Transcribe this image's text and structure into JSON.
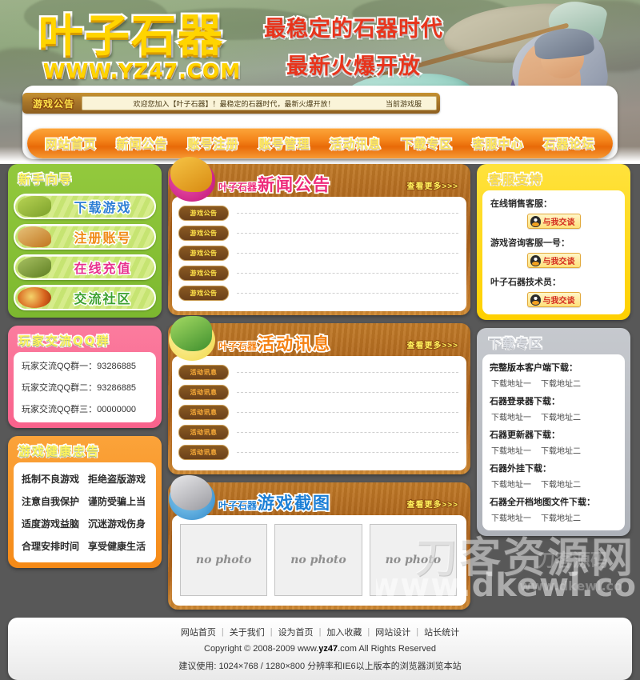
{
  "site": {
    "logo_main": "叶子石器",
    "logo_sub": "WWW.YZ47.COM",
    "slogan_line1": "最稳定的石器时代",
    "slogan_line2": "最新火爆开放"
  },
  "notice": {
    "tag": "游戏公告",
    "text": "欢迎您加入【叶子石器】！最稳定的石器时代，最新火爆开放！",
    "server_label": "当前游戏服"
  },
  "nav": {
    "items": [
      {
        "label": "网站首页"
      },
      {
        "label": "新闻公告"
      },
      {
        "label": "账号注册"
      },
      {
        "label": "账号管理"
      },
      {
        "label": "活动讯息"
      },
      {
        "label": "下载专区"
      },
      {
        "label": "客服中心"
      },
      {
        "label": "石器论坛"
      }
    ]
  },
  "newbie_guide": {
    "title": "新手向导",
    "buttons": [
      {
        "label": "下载游戏",
        "icon": "dino-icon"
      },
      {
        "label": "注册账号",
        "icon": "mammoth-icon"
      },
      {
        "label": "在线充值",
        "icon": "stego-icon"
      },
      {
        "label": "交流社区",
        "icon": "fire-icon"
      }
    ]
  },
  "qq_groups": {
    "title": "玩家交流QQ群",
    "lines": [
      "玩家交流QQ群一：93286885",
      "玩家交流QQ群二：93286885",
      "玩家交流QQ群三：00000000"
    ]
  },
  "health_notice": {
    "title": "游戏健康忠告",
    "items": [
      "抵制不良游戏",
      "拒绝盗版游戏",
      "注意自我保护",
      "谨防受骗上当",
      "适度游戏益脑",
      "沉迷游戏伤身",
      "合理安排时间",
      "享受健康生活"
    ]
  },
  "news_panel": {
    "title_prefix": "叶子石器",
    "title_main": "新闻公告",
    "more": "查看更多>>>",
    "rows": [
      {
        "tag": "游戏公告",
        "text": ""
      },
      {
        "tag": "游戏公告",
        "text": ""
      },
      {
        "tag": "游戏公告",
        "text": ""
      },
      {
        "tag": "游戏公告",
        "text": ""
      },
      {
        "tag": "游戏公告",
        "text": ""
      }
    ]
  },
  "activity_panel": {
    "title_prefix": "叶子石器",
    "title_main": "活动讯息",
    "more": "查看更多>>>",
    "rows": [
      {
        "tag": "活动讯息",
        "text": ""
      },
      {
        "tag": "活动讯息",
        "text": ""
      },
      {
        "tag": "活动讯息",
        "text": ""
      },
      {
        "tag": "活动讯息",
        "text": ""
      },
      {
        "tag": "活动讯息",
        "text": ""
      }
    ]
  },
  "screenshot_panel": {
    "title_prefix": "叶子石器",
    "title_main": "游戏截图",
    "more": "查看更多>>>",
    "shots": [
      {
        "label": "no photo"
      },
      {
        "label": "no photo"
      },
      {
        "label": "no photo"
      }
    ]
  },
  "support_panel": {
    "title": "客服支持",
    "entries": [
      {
        "label": "在线销售客服：",
        "button": "与我交谈"
      },
      {
        "label": "游戏咨询客服一号：",
        "button": "与我交谈"
      },
      {
        "label": "叶子石器技术员：",
        "button": "与我交谈"
      }
    ]
  },
  "download_panel": {
    "title": "下载专区",
    "groups": [
      {
        "head": "完整版本客户端下载：",
        "link1": "下载地址一",
        "link2": "下载地址二"
      },
      {
        "head": "石器登录器下载：",
        "link1": "下载地址一",
        "link2": "下载地址二"
      },
      {
        "head": "石器更新器下载：",
        "link1": "下载地址一",
        "link2": "下载地址二"
      },
      {
        "head": "石器外挂下载：",
        "link1": "下载地址一",
        "link2": "下载地址二"
      },
      {
        "head": "石器全开档地图文件下载：",
        "link1": "下载地址一",
        "link2": "下载地址二"
      }
    ]
  },
  "footer": {
    "links": [
      "网站首页",
      "关于我们",
      "设为首页",
      "加入收藏",
      "网站设计",
      "站长统计"
    ],
    "separator": "|",
    "copyright_pre": "Copyright © 2008-2009 www.",
    "copyright_bold": "yz47",
    "copyright_post": ".com All Rights Reserved",
    "note": "建议使用: 1024×768 / 1280×800 分辨率和IE6以上版本的浏览器浏览本站"
  },
  "watermark": {
    "big": "刀客资源网",
    "url": "www.dkewl.co",
    "sub": "刀客源码",
    "sub2": "www.dkewl.co"
  },
  "colors": {
    "page_bg": "#585858",
    "nav_orange": "#F4841A",
    "green_card": "#7CB82F",
    "pink_card": "#F9628C",
    "orange_card": "#F58A17",
    "yellow_card": "#FFD000",
    "gray_card": "#AEB2B9",
    "wood_brown": "#A85F18"
  }
}
